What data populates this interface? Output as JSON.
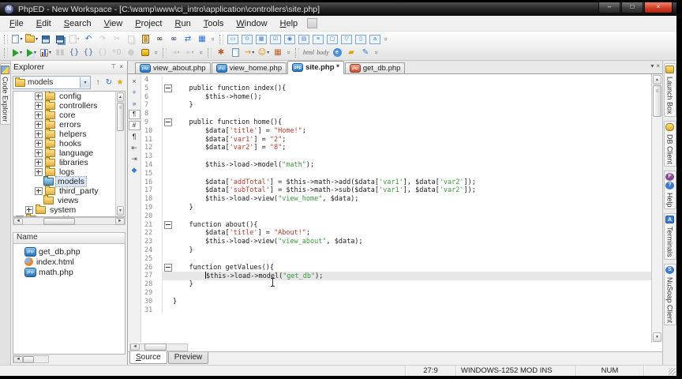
{
  "window_title": "PhpED - New Workspace - [C:\\wamp\\www\\ci_intro\\application\\controllers\\site.php]",
  "menu": [
    "File",
    "Edit",
    "Search",
    "View",
    "Project",
    "Run",
    "Tools",
    "Window",
    "Help"
  ],
  "icons": {
    "minimize": "–",
    "maximize": "□",
    "close": "×",
    "dropdown": "▾",
    "pin": "⊤",
    "overflow": "»",
    "tab_list": "▾",
    "tab_close": "×",
    "scroll_up": "▲",
    "scroll_down": "▼",
    "scroll_left": "◄",
    "scroll_right": "►"
  },
  "accent_colors": {
    "string_red": "#b03a2e",
    "string_green": "#3a9a3a",
    "run_green": "#2ba12b",
    "selection_blue": "#dbe7f5"
  },
  "toolbar": {
    "row1": [
      [
        {
          "name": "new-file",
          "k": "page",
          "dd": true
        },
        {
          "name": "open-file",
          "k": "folder",
          "dd": true
        },
        {
          "name": "save",
          "k": "floppy"
        },
        {
          "name": "save-all",
          "k": "floppy2"
        },
        {
          "name": "save-as",
          "k": "page",
          "dd": true,
          "dis": true
        },
        {
          "name": "undo",
          "k": "g",
          "g": "↶",
          "c": "#2a6fd6"
        },
        {
          "name": "redo",
          "k": "g",
          "g": "↷",
          "c": "#777",
          "dis": true
        },
        {
          "name": "cut",
          "k": "g",
          "g": "✂",
          "c": "#777",
          "dis": true
        },
        {
          "name": "copy",
          "k": "copy",
          "dis": true
        },
        {
          "name": "paste",
          "k": "paste"
        },
        {
          "name": "find",
          "k": "g",
          "g": "∞",
          "c": "#223"
        },
        {
          "name": "find-in-files",
          "k": "g",
          "g": "∞",
          "c": "#125"
        },
        {
          "name": "replace",
          "k": "g",
          "g": "⇄",
          "c": "#2a6fd6"
        },
        {
          "name": "window-list",
          "k": "g",
          "g": "▦",
          "c": "#2a6fd6"
        }
      ],
      [
        {
          "name": "insert-form",
          "k": "form",
          "g": "▭"
        },
        {
          "name": "insert-input",
          "k": "form",
          "g": "⊙"
        },
        {
          "name": "insert-table",
          "k": "form",
          "g": "▦"
        },
        {
          "name": "insert-checkbox",
          "k": "form",
          "g": "☑"
        },
        {
          "name": "insert-radio",
          "k": "form",
          "g": "◉"
        },
        {
          "name": "insert-textarea",
          "k": "form",
          "g": "▤"
        },
        {
          "name": "insert-list",
          "k": "form",
          "g": "≡"
        },
        {
          "name": "insert-div",
          "k": "form",
          "g": "▢"
        },
        {
          "name": "insert-select",
          "k": "form",
          "g": "▽"
        },
        {
          "name": "insert-button",
          "k": "form",
          "g": "▯"
        },
        {
          "name": "insert-label",
          "k": "form",
          "g": "a"
        }
      ]
    ],
    "row2": [
      [
        {
          "name": "run",
          "k": "play",
          "dd": true
        },
        {
          "name": "run-in-debugger",
          "k": "playdoc",
          "dd": true
        },
        {
          "name": "profile",
          "k": "chart",
          "dd": true
        },
        {
          "name": "pause",
          "k": "g",
          "g": "▮▮",
          "c": "#888",
          "dis": true
        },
        {
          "name": "step-into",
          "k": "g",
          "g": "{}",
          "c": "#4a6a9a"
        },
        {
          "name": "step-over",
          "k": "g",
          "g": "{}",
          "c": "#4a6a9a"
        },
        {
          "name": "step-out",
          "k": "g",
          "g": "{}",
          "c": "#888",
          "dis": true
        },
        {
          "name": "run-to-cursor",
          "k": "g",
          "g": "*0",
          "c": "#888",
          "dis": true
        },
        {
          "name": "stop",
          "k": "g",
          "g": "●",
          "c": "#999",
          "dis": true
        },
        {
          "name": "security-settings",
          "k": "lock"
        }
      ],
      [
        {
          "name": "navigate-back",
          "k": "g",
          "g": "◂",
          "c": "#8fa5b5",
          "dd": true,
          "dis": true
        },
        {
          "name": "navigate-forward",
          "k": "g",
          "g": "▸",
          "c": "#8fa5b5",
          "dd": true,
          "dis": true
        }
      ],
      [
        {
          "name": "settings",
          "k": "g",
          "g": "✱",
          "c": "#c05a2a"
        },
        {
          "name": "open-in-browser",
          "k": "page"
        },
        {
          "name": "deploy",
          "k": "g",
          "g": "→",
          "c": "#d98d00",
          "dd": true
        },
        {
          "name": "accounts",
          "k": "g",
          "g": "☺",
          "c": "#d98d00",
          "dd": true
        },
        {
          "name": "color-scheme",
          "k": "g",
          "g": "▦",
          "c": "#c06030"
        }
      ],
      [
        {
          "name": "html-tag",
          "k": "text",
          "g": "html"
        },
        {
          "name": "body-tag",
          "k": "text",
          "g": "body"
        },
        {
          "name": "browser-preview",
          "k": "circ",
          "g": "e",
          "c": "#4a90d9"
        },
        {
          "name": "publish",
          "k": "g",
          "g": "▰",
          "c": "#d9a400"
        },
        {
          "name": "edit-pencil",
          "k": "g",
          "g": "✎",
          "c": "#3a7ad0"
        }
      ]
    ]
  },
  "left_strip": {
    "label": "Code Explorer"
  },
  "explorer": {
    "title": "Explorer",
    "filter_value": "models",
    "buttons": [
      {
        "name": "go-up",
        "g": "↑",
        "c": "#2e8b2e"
      },
      {
        "name": "refresh",
        "g": "↻",
        "c": "#2a6fd6"
      },
      {
        "name": "favorites",
        "g": "★",
        "c": "#e0a800"
      }
    ],
    "tree": [
      {
        "label": "config",
        "lvl": 2,
        "exp": true
      },
      {
        "label": "controllers",
        "lvl": 2,
        "exp": true
      },
      {
        "label": "core",
        "lvl": 2,
        "exp": true
      },
      {
        "label": "errors",
        "lvl": 2,
        "exp": true
      },
      {
        "label": "helpers",
        "lvl": 2,
        "exp": true
      },
      {
        "label": "hooks",
        "lvl": 2,
        "exp": true
      },
      {
        "label": "language",
        "lvl": 2,
        "exp": true
      },
      {
        "label": "libraries",
        "lvl": 2,
        "exp": true
      },
      {
        "label": "logs",
        "lvl": 2,
        "exp": true
      },
      {
        "label": "models",
        "lvl": 2,
        "exp": false,
        "sel": true
      },
      {
        "label": "third_party",
        "lvl": 2,
        "exp": true
      },
      {
        "label": "views",
        "lvl": 2,
        "exp": false
      },
      {
        "label": "system",
        "lvl": 1,
        "exp": true
      },
      {
        "label": "something",
        "lvl": 0,
        "exp": true
      }
    ],
    "list_header": "Name",
    "files": [
      {
        "name": "get_db.php",
        "type": "php"
      },
      {
        "name": "index.html",
        "type": "html"
      },
      {
        "name": "math.php",
        "type": "php"
      }
    ]
  },
  "editor": {
    "tabs": [
      {
        "label": "view_about.php",
        "icon": "php"
      },
      {
        "label": "view_home.php",
        "icon": "php"
      },
      {
        "label": "site.php *",
        "icon": "php",
        "active": true
      },
      {
        "label": "get_db.php",
        "icon": "php-red"
      }
    ],
    "side_icons": [
      {
        "name": "close-file",
        "g": "×",
        "c": "#555"
      },
      {
        "name": "add-bookmark",
        "g": "+",
        "c": "#2a6fd6"
      },
      {
        "name": "show-special-chars",
        "g": "»",
        "c": "#4a6a9a"
      },
      {
        "name": "highlight-matches",
        "g": "¶",
        "c": "#333",
        "box": true
      },
      {
        "name": "toggle-line-numbers",
        "g": "#",
        "c": "#333",
        "box": true
      },
      {
        "name": "show-paragraph-marks",
        "g": "¶",
        "c": "#333"
      },
      {
        "name": "outdent",
        "g": "⇤",
        "c": "#555"
      },
      {
        "name": "indent",
        "g": "⇥",
        "c": "#555"
      },
      {
        "name": "php-syntax-check",
        "g": "◆",
        "c": "#3a7ad0"
      }
    ],
    "current_line": 27,
    "lines": [
      {
        "n": 4,
        "s": []
      },
      {
        "n": 5,
        "f": 1,
        "s": [
          [
            "",
            "    public function index(){"
          ]
        ]
      },
      {
        "n": 6,
        "s": [
          [
            "",
            "        $this->home();"
          ]
        ]
      },
      {
        "n": 7,
        "s": [
          [
            "",
            "    }"
          ]
        ]
      },
      {
        "n": 8,
        "s": []
      },
      {
        "n": 9,
        "f": 1,
        "s": [
          [
            "",
            "    public function home(){"
          ]
        ]
      },
      {
        "n": 10,
        "s": [
          [
            "",
            "        $data["
          ],
          [
            "r",
            "'title'"
          ],
          [
            "",
            "] = "
          ],
          [
            "r",
            "\"Home!\""
          ],
          [
            "",
            ";"
          ]
        ]
      },
      {
        "n": 11,
        "s": [
          [
            "",
            "        $data["
          ],
          [
            "r",
            "'var1'"
          ],
          [
            "",
            "] = "
          ],
          [
            "r",
            "\"2\""
          ],
          [
            "",
            ";"
          ]
        ]
      },
      {
        "n": 12,
        "s": [
          [
            "",
            "        $data["
          ],
          [
            "r",
            "'var2'"
          ],
          [
            "",
            "] = "
          ],
          [
            "r",
            "\"8\""
          ],
          [
            "",
            ";"
          ]
        ]
      },
      {
        "n": 13,
        "s": []
      },
      {
        "n": 14,
        "s": [
          [
            "",
            "        $this->load->model("
          ],
          [
            "g",
            "\"math\""
          ],
          [
            "",
            ");"
          ]
        ]
      },
      {
        "n": 15,
        "s": []
      },
      {
        "n": 16,
        "s": [
          [
            "",
            "        $data["
          ],
          [
            "r",
            "'addTotal'"
          ],
          [
            "",
            "] = $this->math->add($data["
          ],
          [
            "g",
            "'var1'"
          ],
          [
            "",
            "], $data["
          ],
          [
            "g",
            "'var2'"
          ],
          [
            "",
            "]);"
          ]
        ]
      },
      {
        "n": 17,
        "s": [
          [
            "",
            "        $data["
          ],
          [
            "r",
            "'subTotal'"
          ],
          [
            "",
            "] = $this->math->sub($data["
          ],
          [
            "g",
            "'var1'"
          ],
          [
            "",
            "], $data["
          ],
          [
            "g",
            "'var2'"
          ],
          [
            "",
            "]);"
          ]
        ]
      },
      {
        "n": 18,
        "s": [
          [
            "",
            "        $this->load->view("
          ],
          [
            "g",
            "\"view_home\""
          ],
          [
            "",
            ", $data);"
          ]
        ]
      },
      {
        "n": 19,
        "s": [
          [
            "",
            "    }"
          ]
        ]
      },
      {
        "n": 20,
        "s": []
      },
      {
        "n": 21,
        "f": 1,
        "s": [
          [
            "",
            "    function about(){"
          ]
        ]
      },
      {
        "n": 22,
        "s": [
          [
            "",
            "        $data["
          ],
          [
            "r",
            "'title'"
          ],
          [
            "",
            "] = "
          ],
          [
            "r",
            "\"About!\""
          ],
          [
            "",
            ";"
          ]
        ]
      },
      {
        "n": 23,
        "s": [
          [
            "",
            "        $this->load->view("
          ],
          [
            "g",
            "\"view_about\""
          ],
          [
            "",
            ", $data);"
          ]
        ]
      },
      {
        "n": 24,
        "s": [
          [
            "",
            "    }"
          ]
        ]
      },
      {
        "n": 25,
        "s": []
      },
      {
        "n": 26,
        "f": 1,
        "s": [
          [
            "",
            "    function getValues(){"
          ]
        ]
      },
      {
        "n": 27,
        "cur": 1,
        "s": [
          [
            "",
            "        "
          ],
          [
            "caret",
            ""
          ],
          [
            "",
            "$this->load->model("
          ],
          [
            "g",
            "\"get_db\""
          ],
          [
            "",
            ");"
          ]
        ]
      },
      {
        "n": 28,
        "s": [
          [
            "",
            "    }"
          ]
        ]
      },
      {
        "n": 29,
        "s": []
      },
      {
        "n": 30,
        "s": [
          [
            "",
            "}"
          ]
        ]
      },
      {
        "n": 31,
        "s": []
      }
    ],
    "bottom_tabs": [
      {
        "label": "Source",
        "active": true,
        "u": true
      },
      {
        "label": "Preview"
      }
    ]
  },
  "right_strip": [
    {
      "label": "Launch Box",
      "icons": [
        {
          "t": "ysq"
        }
      ]
    },
    {
      "label": "DB Client",
      "icons": [
        {
          "t": "ycyl"
        }
      ]
    },
    {
      "label": "Help",
      "icons": [
        {
          "t": "circ",
          "g": "F",
          "c": "#8a4a9a"
        },
        {
          "t": "circ",
          "g": "?",
          "c": "#3a7ad0"
        }
      ]
    },
    {
      "label": "Terminals",
      "icons": [
        {
          "t": "bsq",
          "g": "A"
        }
      ]
    },
    {
      "label": "NuSoap Client",
      "icons": [
        {
          "t": "circ",
          "g": "S",
          "c": "#3a7ad0"
        }
      ]
    }
  ],
  "statusbar": {
    "cells": [
      "",
      "27:9",
      "WINDOWS-1252 MOD INS",
      "NUM",
      ""
    ],
    "names": [
      "status-spacer",
      "cursor-position",
      "encoding-mode-indicators",
      "numlock-indicator",
      "status-end"
    ]
  }
}
